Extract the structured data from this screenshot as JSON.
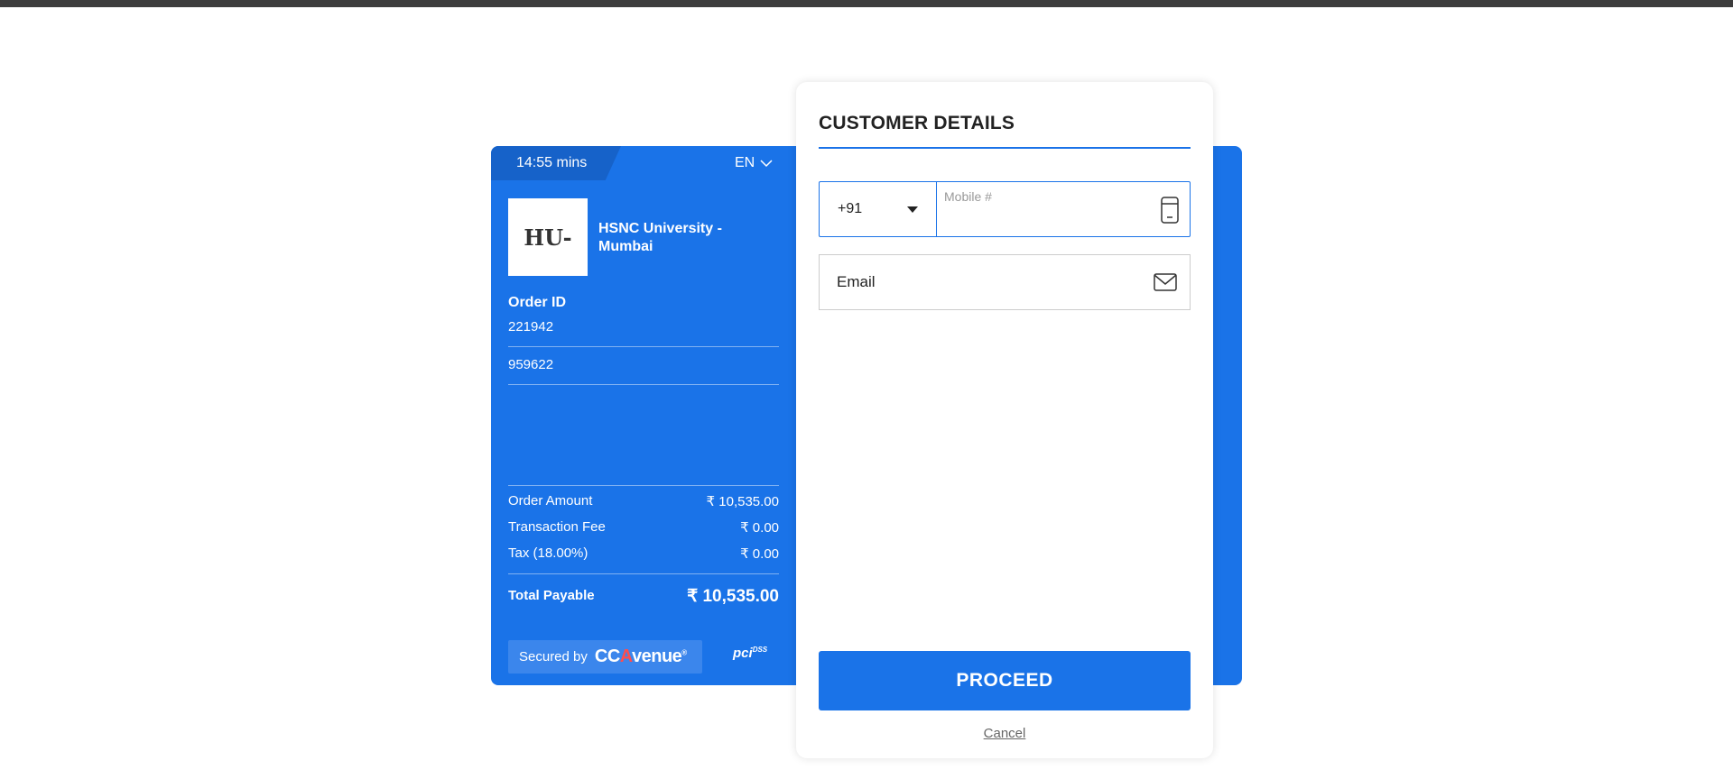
{
  "timer": {
    "value": "14:55",
    "unit": "mins"
  },
  "language": {
    "selected": "EN"
  },
  "merchant": {
    "logo_text": "HU-",
    "name": "HSNC University - Mumbai"
  },
  "order": {
    "label": "Order ID",
    "id": "221942",
    "ref": "959622"
  },
  "summary": {
    "rows": [
      {
        "label": "Order Amount",
        "value": "₹ 10,535.00"
      },
      {
        "label": "Transaction Fee",
        "value": "₹ 0.00"
      },
      {
        "label": "Tax (18.00%)",
        "value": "₹ 0.00"
      }
    ],
    "total_label": "Total Payable",
    "total_value": "₹  10,535.00"
  },
  "footer": {
    "secured_by": "Secured by",
    "brand_cc": "CC",
    "brand_a": "A",
    "brand_rest": "venue",
    "brand_mark": "®",
    "pci": "pci",
    "pci_dss": "DSS"
  },
  "customer": {
    "title": "CUSTOMER DETAILS",
    "country_code": "+91",
    "mobile_placeholder": "Mobile #",
    "mobile_value": "",
    "email_placeholder": "Email",
    "email_value": ""
  },
  "actions": {
    "proceed": "PROCEED",
    "cancel": "Cancel"
  },
  "colors": {
    "primary": "#1a73e8",
    "topbar": "#3d3d3d"
  }
}
